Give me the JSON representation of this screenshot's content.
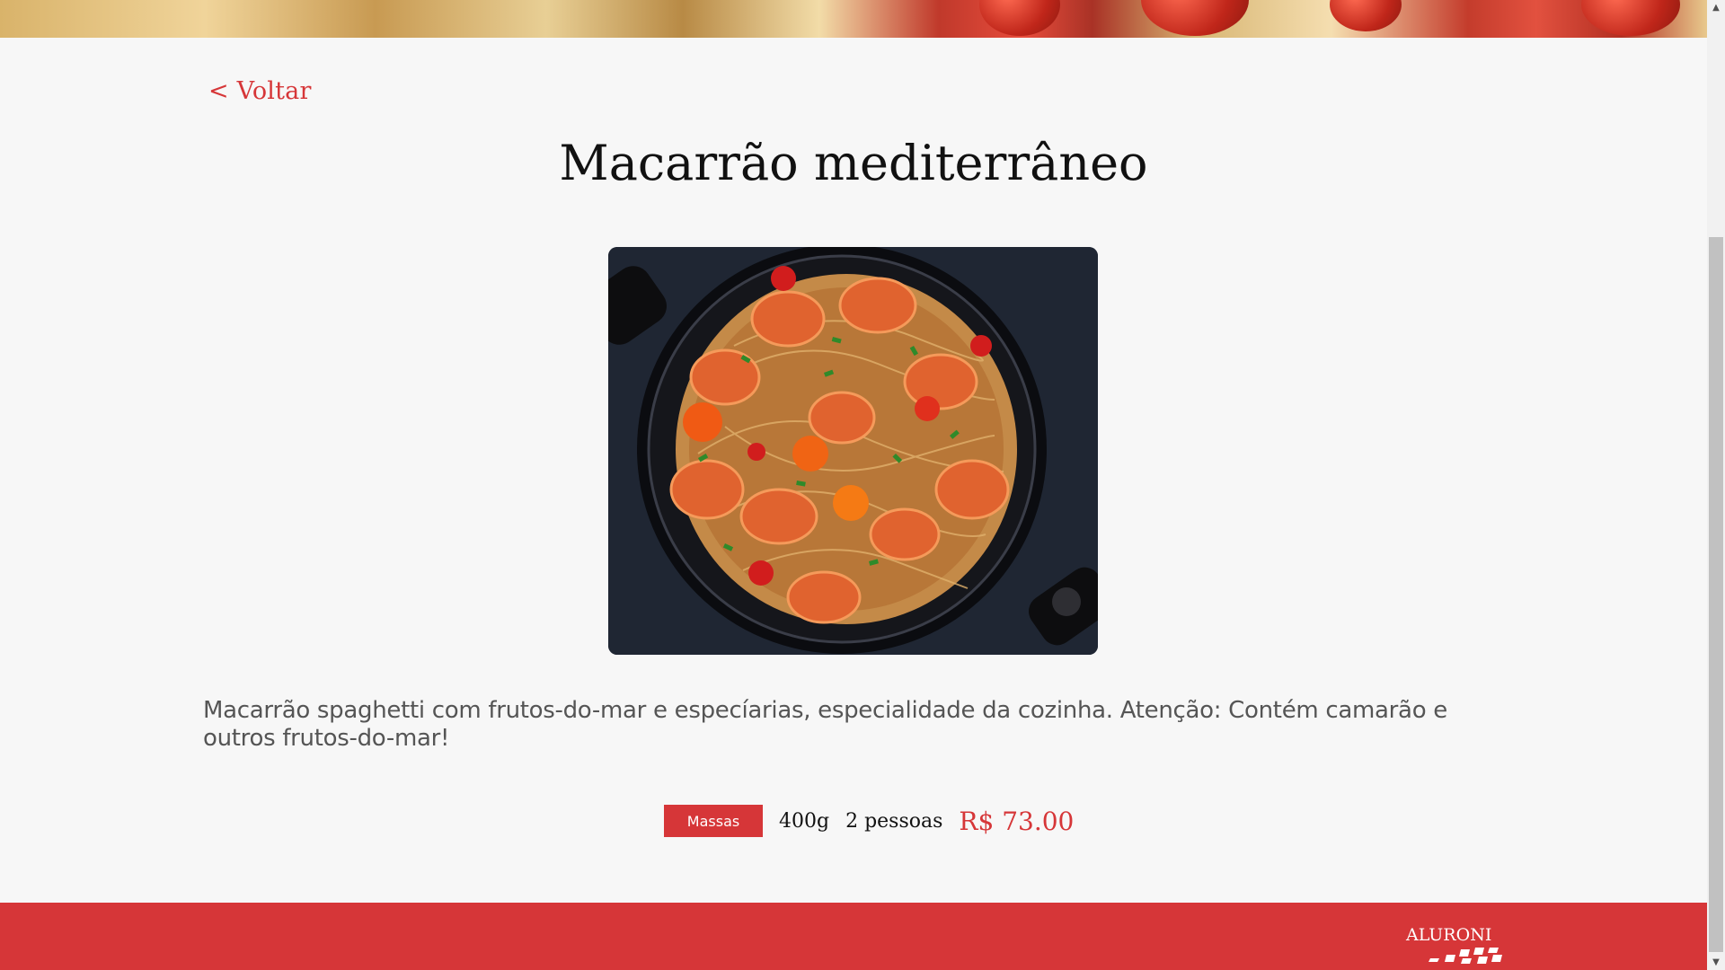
{
  "nav": {
    "back_label": "< Voltar"
  },
  "dish": {
    "title": "Macarrão mediterrâneo",
    "description": "Macarrão spaghetti com frutos-do-mar e especíarias, especialidade da cozinha. Atenção: Contém camarão e outros frutos-do-mar!",
    "category": "Massas",
    "weight": "400g",
    "serves": "2 pessoas",
    "price": "R$ 73.00"
  },
  "footer": {
    "logo_text": "ALURONI"
  },
  "colors": {
    "accent": "#d63638",
    "background": "#f7f7f7"
  },
  "icons": {
    "scroll_up": "triangle-up-icon",
    "scroll_down": "triangle-down-icon",
    "logo_flag": "checkered-flag-icon"
  }
}
